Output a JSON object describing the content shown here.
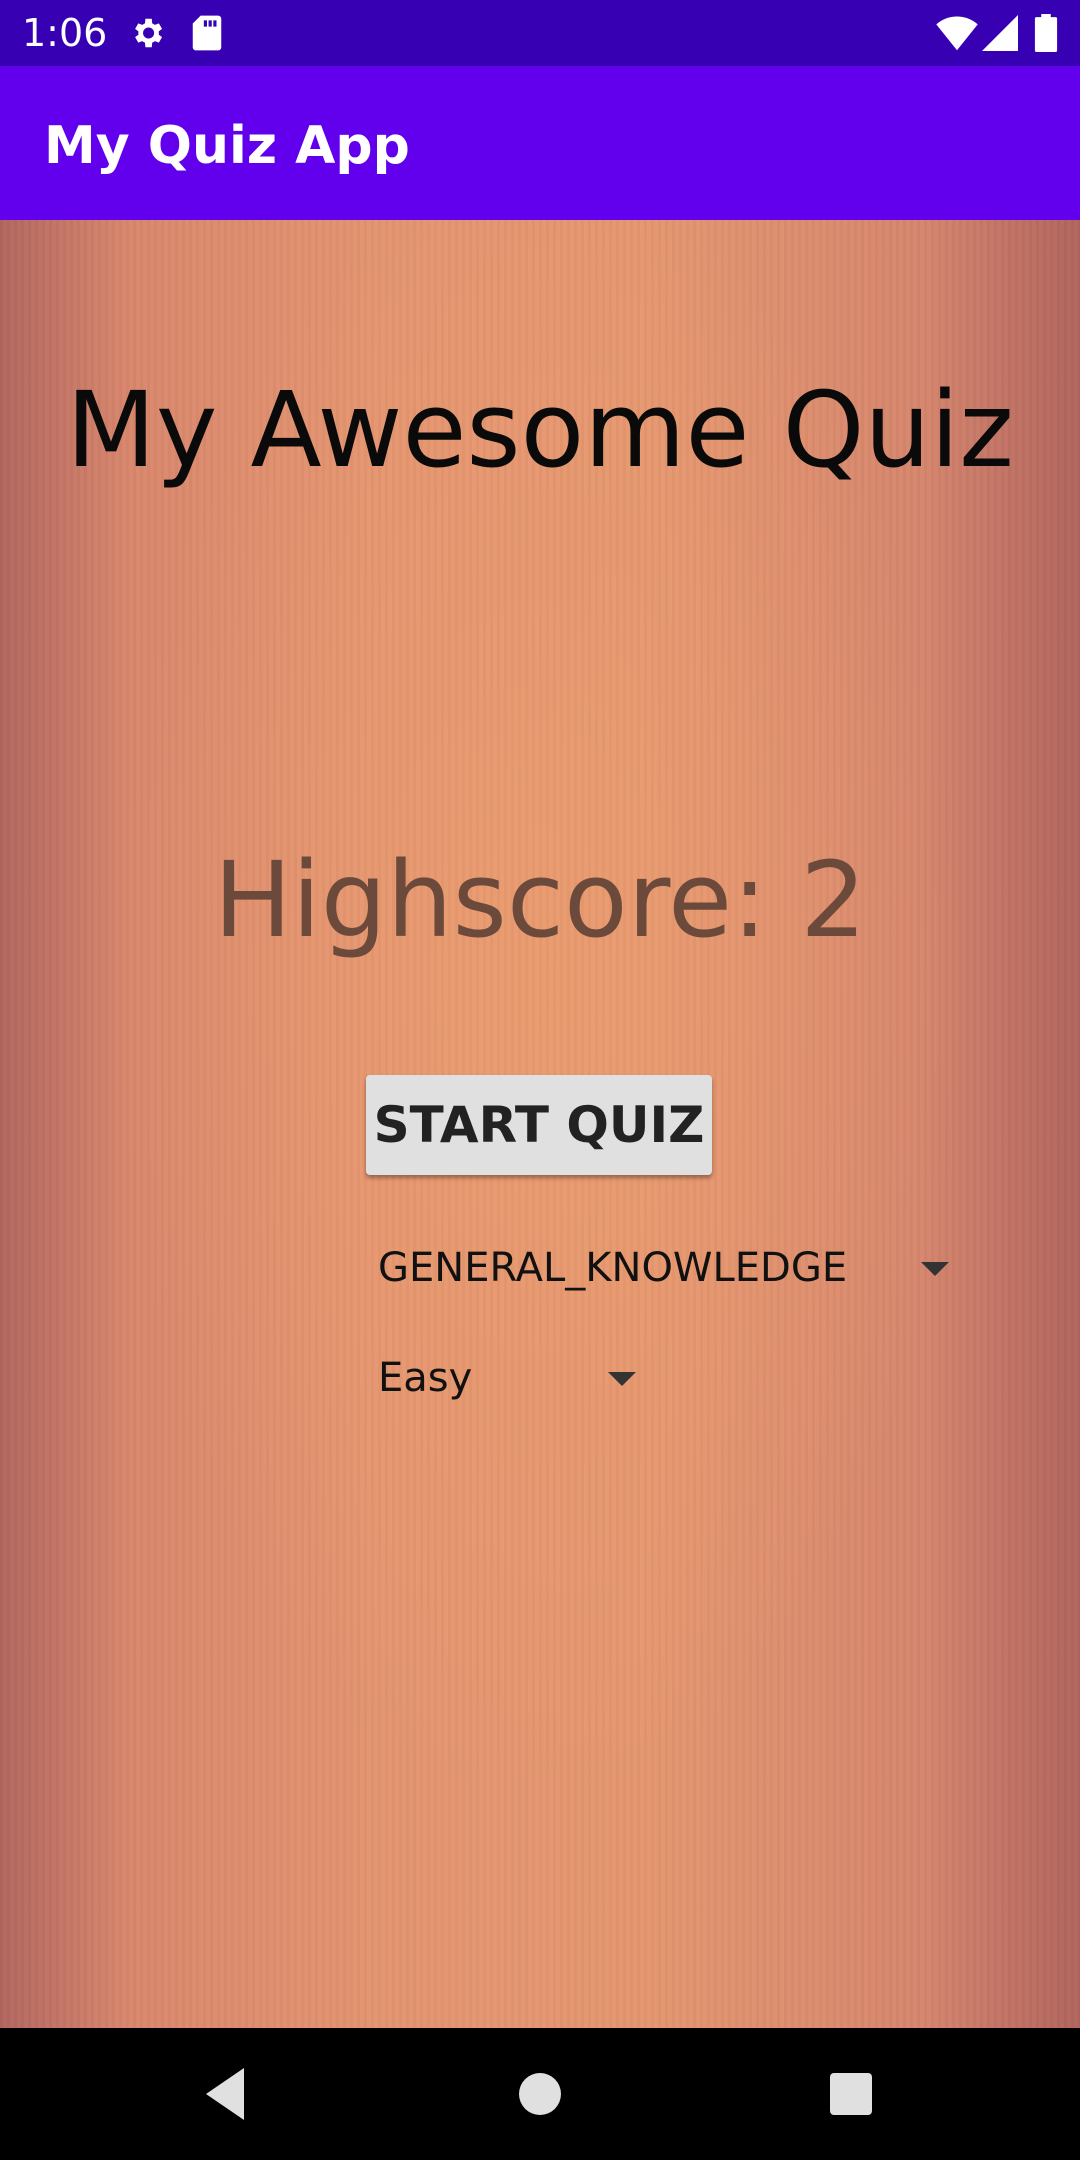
{
  "status_bar": {
    "time": "1:06",
    "icons": [
      "settings-icon",
      "sd-card-icon",
      "wifi-icon",
      "signal-icon",
      "battery-icon"
    ]
  },
  "app_bar": {
    "title": "My Quiz App",
    "color": "#6200EE"
  },
  "main": {
    "title": "My Awesome Quiz",
    "highscore": "Highscore: 2",
    "start_button_label": "START QUIZ",
    "category_spinner": {
      "selected": "GENERAL_KNOWLEDGE"
    },
    "difficulty_spinner": {
      "selected": "Easy"
    }
  },
  "nav_bar": {
    "buttons": [
      "back-icon",
      "home-icon",
      "recents-icon"
    ]
  }
}
